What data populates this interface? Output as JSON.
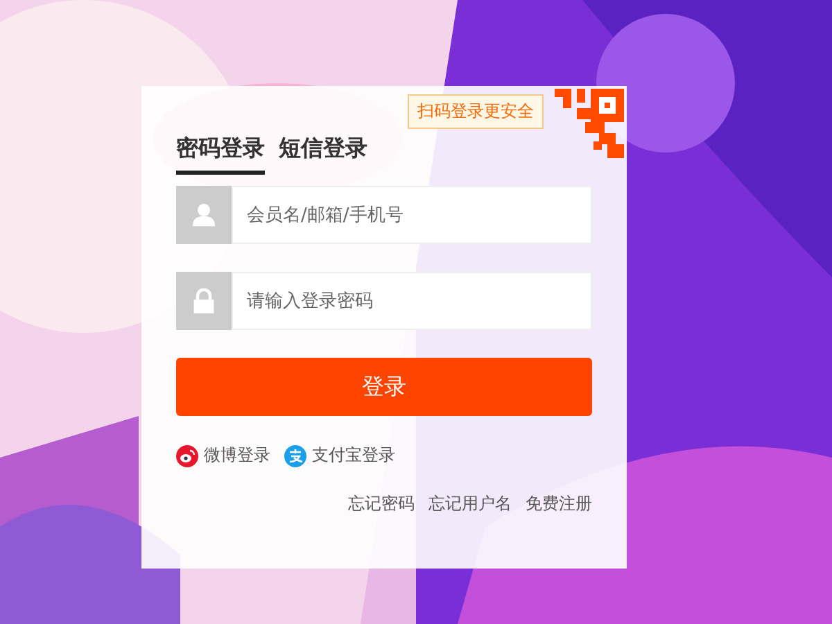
{
  "qr_tip": "扫码登录更安全",
  "tabs": [
    {
      "label": "密码登录",
      "selected": true
    },
    {
      "label": "短信登录",
      "selected": false
    }
  ],
  "username": {
    "placeholder": "会员名/邮箱/手机号"
  },
  "password": {
    "placeholder": "请输入登录密码"
  },
  "login_button": "登录",
  "social_logins": [
    {
      "kind": "weibo",
      "label": "微博登录"
    },
    {
      "kind": "alipay",
      "label": "支付宝登录"
    }
  ],
  "links": [
    "忘记密码",
    "忘记用户名",
    "免费注册"
  ]
}
